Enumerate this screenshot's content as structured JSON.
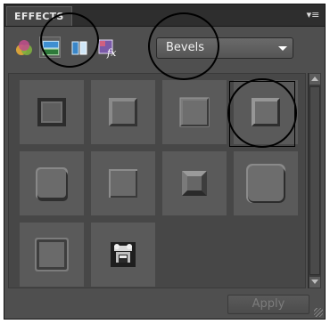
{
  "panel": {
    "title": "EFFECTS",
    "menu_icon": "panel-menu-icon",
    "menu_glyph": "▾≡"
  },
  "toolbar": {
    "tools": [
      {
        "name": "filters-tool",
        "icon": "filters-icon"
      },
      {
        "name": "layer-styles-tool",
        "icon": "layer-styles-icon",
        "selected": true
      },
      {
        "name": "photo-effects-tool",
        "icon": "photo-effects-icon"
      },
      {
        "name": "all-effects-tool",
        "icon": "fx-icon"
      }
    ],
    "category_select": {
      "value": "Bevels"
    }
  },
  "thumbnails": [
    {
      "style": "simple-inner"
    },
    {
      "style": "simple-outer"
    },
    {
      "style": "simple-pillow"
    },
    {
      "style": "simple-sharp",
      "highlighted": true
    },
    {
      "style": "scalloped-edge"
    },
    {
      "style": "simple-emboss"
    },
    {
      "style": "inner-ridge"
    },
    {
      "style": "rounded-edge"
    },
    {
      "style": "wacky-metal"
    },
    {
      "style": "photo-bevel"
    }
  ],
  "footer": {
    "apply_label": "Apply",
    "apply_enabled": false
  },
  "colors": {
    "panel_bg": "#4f4f4f",
    "title_bg": "#2e2e2e",
    "thumb_bg": "#5a5a5a",
    "annotation": "#000000"
  }
}
